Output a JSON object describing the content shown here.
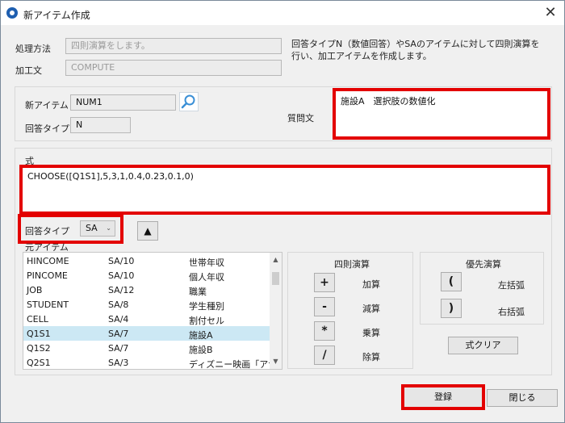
{
  "window": {
    "title": "新アイテム作成",
    "close_glyph": "✕"
  },
  "header": {
    "method_label": "処理方法",
    "method_value": "四則演算をします。",
    "process_label": "加工文",
    "process_value": "COMPUTE",
    "description_line1": "回答タイプN（数値回答）やSAのアイテムに対して四則演算を",
    "description_line2": "行い、加工アイテムを作成します。"
  },
  "item": {
    "new_item_label": "新アイテム",
    "new_item_value": "NUM1",
    "answer_type_label": "回答タイプ",
    "answer_type_value": "N",
    "question_label": "質問文",
    "question_value": "施設A　選択肢の数値化"
  },
  "formula": {
    "label": "式",
    "value": "CHOOSE([Q1S1],5,3,1,0.4,0.23,0.1,0)"
  },
  "filter": {
    "answer_type_label": "回答タイプ",
    "answer_type_selected": "SA",
    "up_glyph": "▲"
  },
  "source_items": {
    "label": "元アイテム",
    "rows": [
      {
        "name": "HINCOME",
        "type": "SA/10",
        "desc": "世帯年収",
        "selected": false
      },
      {
        "name": "PINCOME",
        "type": "SA/10",
        "desc": "個人年収",
        "selected": false
      },
      {
        "name": "JOB",
        "type": "SA/12",
        "desc": "職業",
        "selected": false
      },
      {
        "name": "STUDENT",
        "type": "SA/8",
        "desc": "学生種別",
        "selected": false
      },
      {
        "name": "CELL",
        "type": "SA/4",
        "desc": "割付セル",
        "selected": false
      },
      {
        "name": "Q1S1",
        "type": "SA/7",
        "desc": "施設A",
        "selected": true
      },
      {
        "name": "Q1S2",
        "type": "SA/7",
        "desc": "施設B",
        "selected": false
      },
      {
        "name": "Q2S1",
        "type": "SA/3",
        "desc": "ディズニー映画「アナと雪",
        "selected": false
      }
    ]
  },
  "arith": {
    "title": "四則演算",
    "ops": [
      {
        "glyph": "+",
        "label": "加算"
      },
      {
        "glyph": "-",
        "label": "減算"
      },
      {
        "glyph": "*",
        "label": "乗算"
      },
      {
        "glyph": "/",
        "label": "除算"
      }
    ]
  },
  "priority": {
    "title": "優先演算",
    "left_glyph": "(",
    "left_label": "左括弧",
    "right_glyph": ")",
    "right_label": "右括弧",
    "clear_label": "式クリア"
  },
  "footer": {
    "register_label": "登録",
    "close_label": "閉じる"
  },
  "colors": {
    "highlight": "#e30000",
    "selection": "#cce8f4"
  }
}
